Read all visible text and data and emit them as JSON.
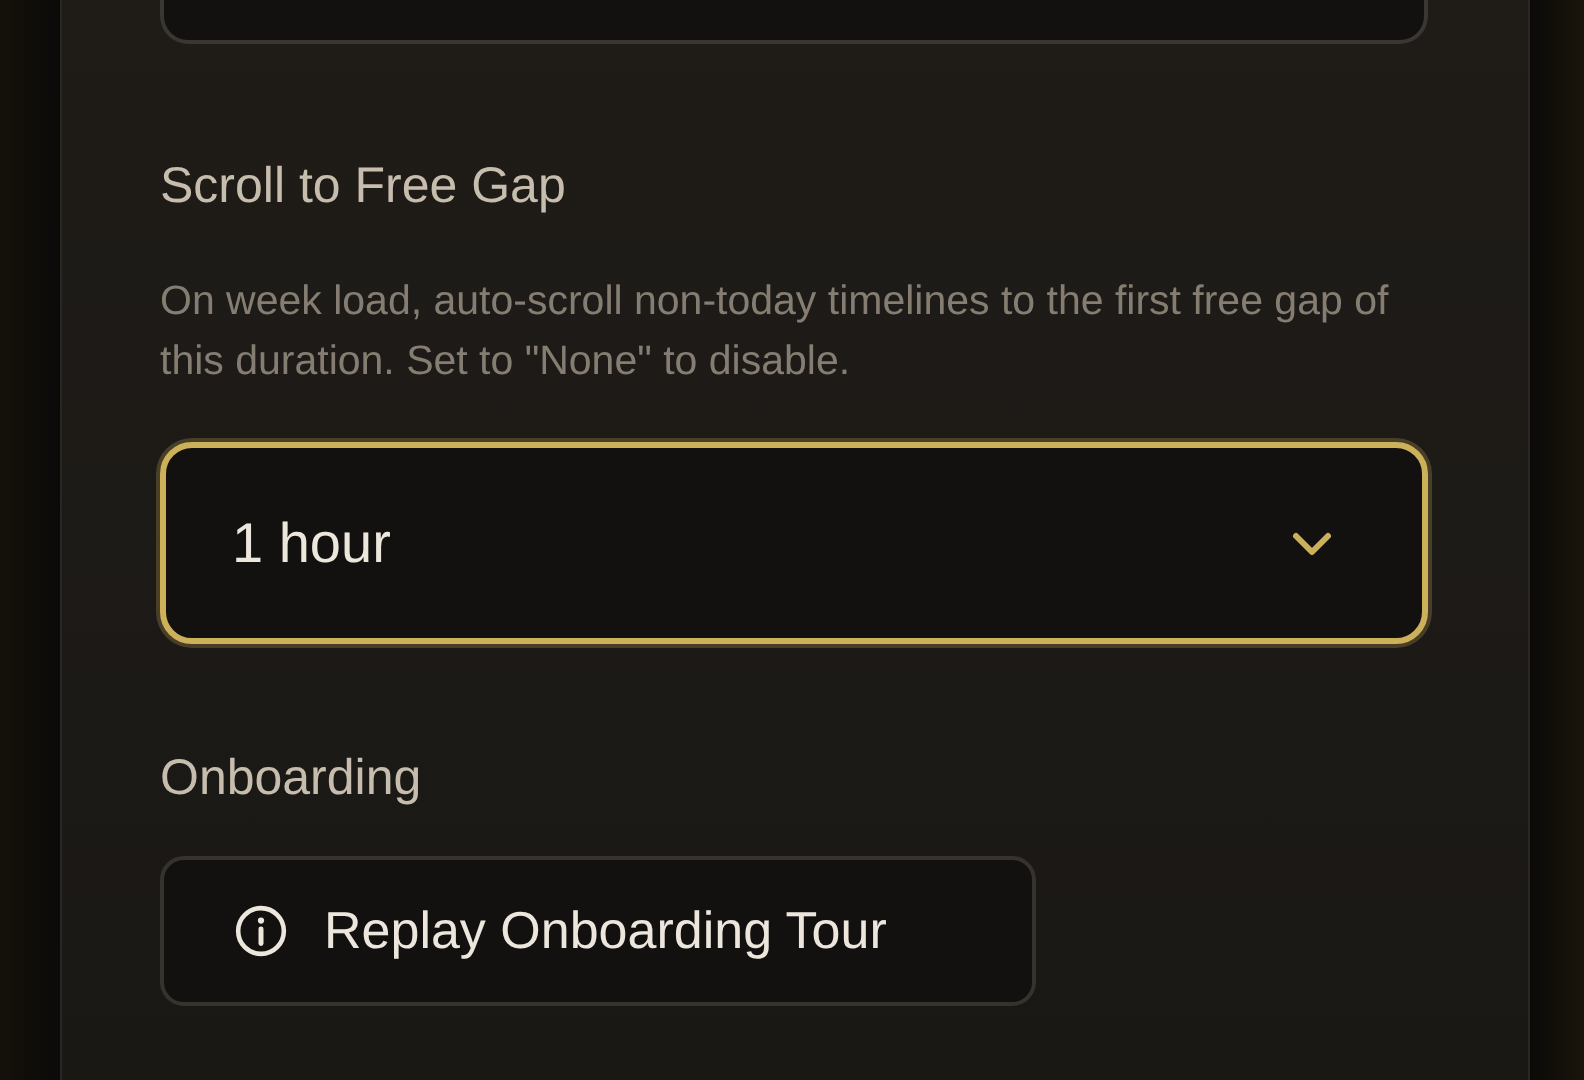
{
  "scroll_to_free_gap": {
    "title": "Scroll to Free Gap",
    "description": "On week load, auto-scroll non-today timelines to the first free gap of this duration. Set to \"None\" to disable.",
    "select": {
      "value": "1 hour",
      "focused": true
    }
  },
  "onboarding": {
    "title": "Onboarding",
    "button": "Replay Onboarding Tour"
  }
}
